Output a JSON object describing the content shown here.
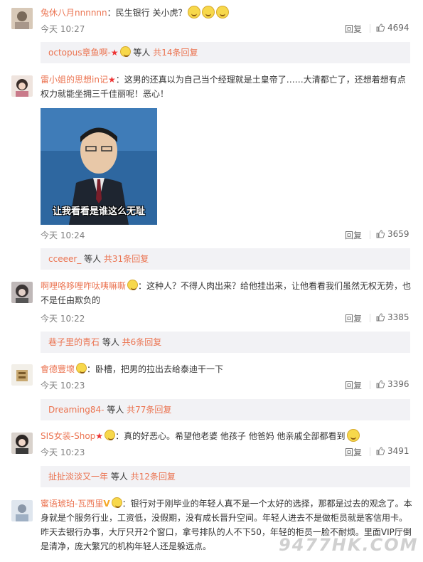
{
  "comments": [
    {
      "user": "兔休八月nnnnnn",
      "text": "：民生银行 关小虎？",
      "time": "今天 10:27",
      "reply": "回复",
      "likes": "4694",
      "sub": null
    },
    {
      "user": "雷小姐的思想in记",
      "text": "：这男的还真以为自己当个经理就是土皇帝了……大清都亡了，还想着想有点权力就能坐拥三千佳丽呢！恶心！",
      "image_caption": "让我看看是谁这么无耻",
      "time": "今天 10:24",
      "reply": "回复",
      "likes": "3659",
      "sub": {
        "name": "cceeer_",
        "mid": " 等人 ",
        "more": "共31条回复"
      }
    },
    {
      "user": "啊哩咯哆哩咋呔咦嘛嘶",
      "text": "：这种人？不得人肉出来？给他挂出来，让他看看我们虽然无权无势，也不是任由欺负的",
      "time": "今天 10:22",
      "reply": "回复",
      "likes": "3385",
      "sub": {
        "name": "巷子里的青石",
        "mid": " 等人 ",
        "more": "共6条回复"
      }
    },
    {
      "user": "會德豐壞",
      "text": "：卧槽，把男的拉出去给泰迪干一下",
      "time": "今天 10:23",
      "reply": "回复",
      "likes": "3396",
      "sub": {
        "name": "Dreaming84-",
        "mid": " 等人 ",
        "more": "共77条回复"
      }
    },
    {
      "user": "SIS女装-Shop",
      "text": "：真的好恶心。希望他老婆 他孩子  他爸妈 他亲戚全部都看到",
      "time": "今天 10:23",
      "reply": "回复",
      "likes": "3491",
      "sub": {
        "name": "扯扯淡淡又一年",
        "mid": " 等人 ",
        "more": "共12条回复"
      }
    },
    {
      "user": "蜜语琥珀-瓦西里",
      "text": "：银行对于刚毕业的年轻人真不是一个太好的选择，那都是过去的观念了。本身就是个服务行业，工资低，没假期，没有成长晋升空间。年轻人进去不是做柜员就是客信用卡。  昨天去银行办事，大厅只开2个窗口，拿号排队的人不下50，年轻的柜员一脸不耐烦。里面VIP厅倒是清净，庞大繁冗的机构年轻人还是躲远点。"
    }
  ],
  "top_sub": {
    "name": "octopus章鱼啊-",
    "mid": " 等人 ",
    "more": "共14条回复"
  },
  "watermark": "9477HK.COM",
  "colors": {
    "username": "#eb7350",
    "subbox": "#f2f2f5"
  }
}
